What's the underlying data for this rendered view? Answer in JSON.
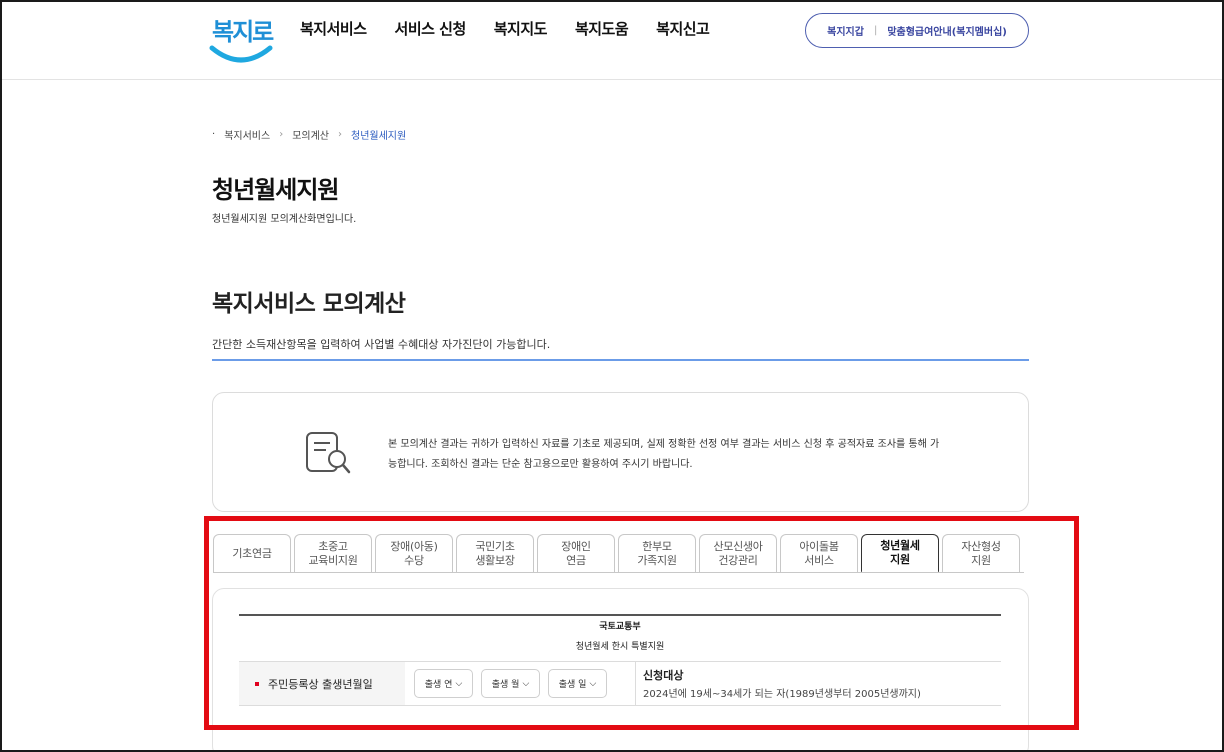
{
  "header": {
    "logo_text": "복지로",
    "nav": [
      "복지서비스",
      "서비스 신청",
      "복지지도",
      "복지도움",
      "복지신고"
    ],
    "util_links": [
      "복지지갑",
      "맞춤형급여안내(복지멤버십)"
    ]
  },
  "breadcrumb": {
    "bullet": "·",
    "items": [
      "복지서비스",
      "모의계산",
      "청년월세지원"
    ]
  },
  "page": {
    "title": "청년월세지원",
    "subtitle": "청년월세지원 모의계산화면입니다."
  },
  "section": {
    "title": "복지서비스 모의계산",
    "description": "간단한 소득재산항목을 입력하여 사업별 수혜대상 자가진단이 가능합니다."
  },
  "notice": {
    "text": "본 모의계산 결과는 귀하가 입력하신 자료를 기초로 제공되며, 실제 정확한 선정 여부 결과는 서비스 신청 후 공적자료 조사를 통해 가능합니다. 조회하신 결과는 단순 참고용으로만 활용하여 주시기 바랍니다."
  },
  "tabs": [
    {
      "line1": "기초연금",
      "line2": ""
    },
    {
      "line1": "초중고",
      "line2": "교육비지원"
    },
    {
      "line1": "장애(아동)",
      "line2": "수당"
    },
    {
      "line1": "국민기초",
      "line2": "생활보장"
    },
    {
      "line1": "장애인",
      "line2": "연금"
    },
    {
      "line1": "한부모",
      "line2": "가족지원"
    },
    {
      "line1": "산모신생아",
      "line2": "건강관리"
    },
    {
      "line1": "아이돌봄",
      "line2": "서비스"
    },
    {
      "line1": "청년월세",
      "line2": "지원"
    },
    {
      "line1": "자산형성",
      "line2": "지원"
    }
  ],
  "active_tab_index": 8,
  "table": {
    "ministry": "국토교통부",
    "program": "청년월세 한시 특별지원",
    "row_label": "주민등록상 출생년월일",
    "selects": [
      "출생 연",
      "출생 월",
      "출생 일"
    ],
    "eligibility_title": "신청대상",
    "eligibility_desc": "2024년에 19세~34세가 되는 자(1989년생부터 2005년생까지)"
  },
  "colors": {
    "accent_blue": "#6b9ce8",
    "highlight_red": "#e30b13",
    "logo_blue": "#1f8fd6"
  }
}
